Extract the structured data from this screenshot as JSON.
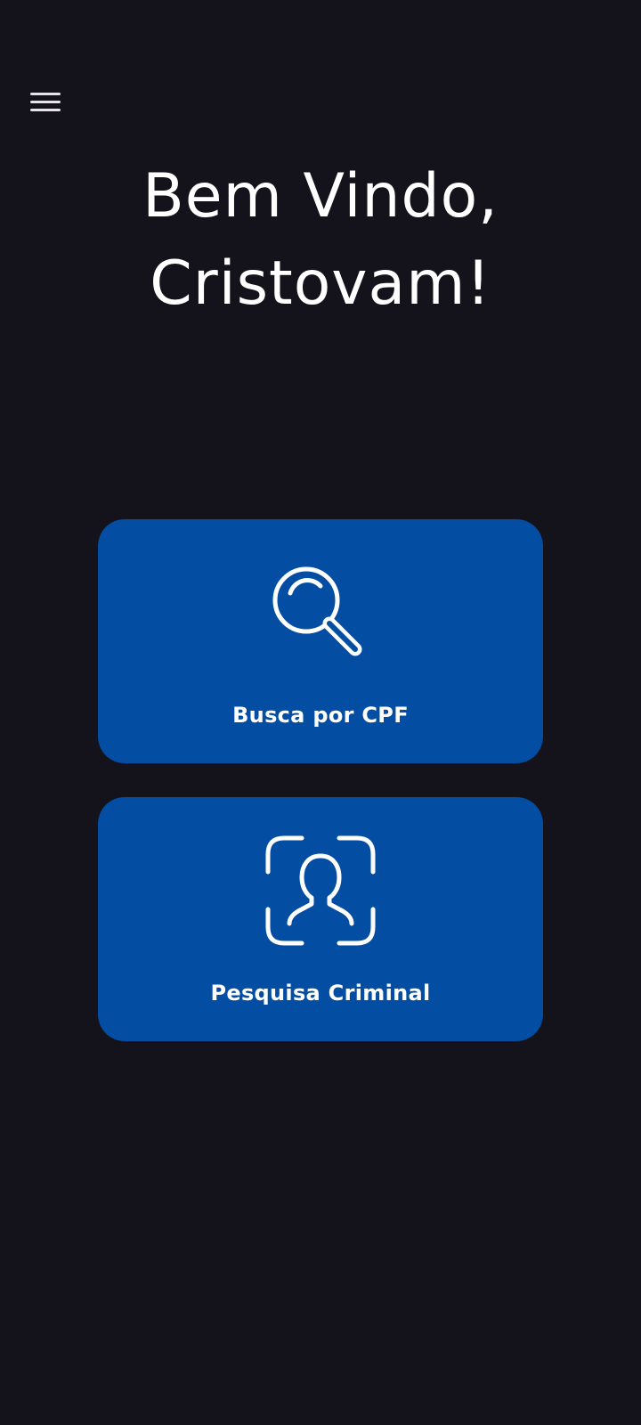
{
  "header": {
    "menu_icon": "hamburger-menu-icon",
    "greeting_line1": "Bem Vindo,",
    "greeting_line2": "Cristovam!"
  },
  "actions": [
    {
      "label": "Busca por CPF",
      "icon": "magnifying-glass-icon"
    },
    {
      "label": "Pesquisa Criminal",
      "icon": "face-scan-icon"
    }
  ],
  "colors": {
    "background": "#14121a",
    "card": "#034ea2",
    "text": "#ffffff"
  }
}
